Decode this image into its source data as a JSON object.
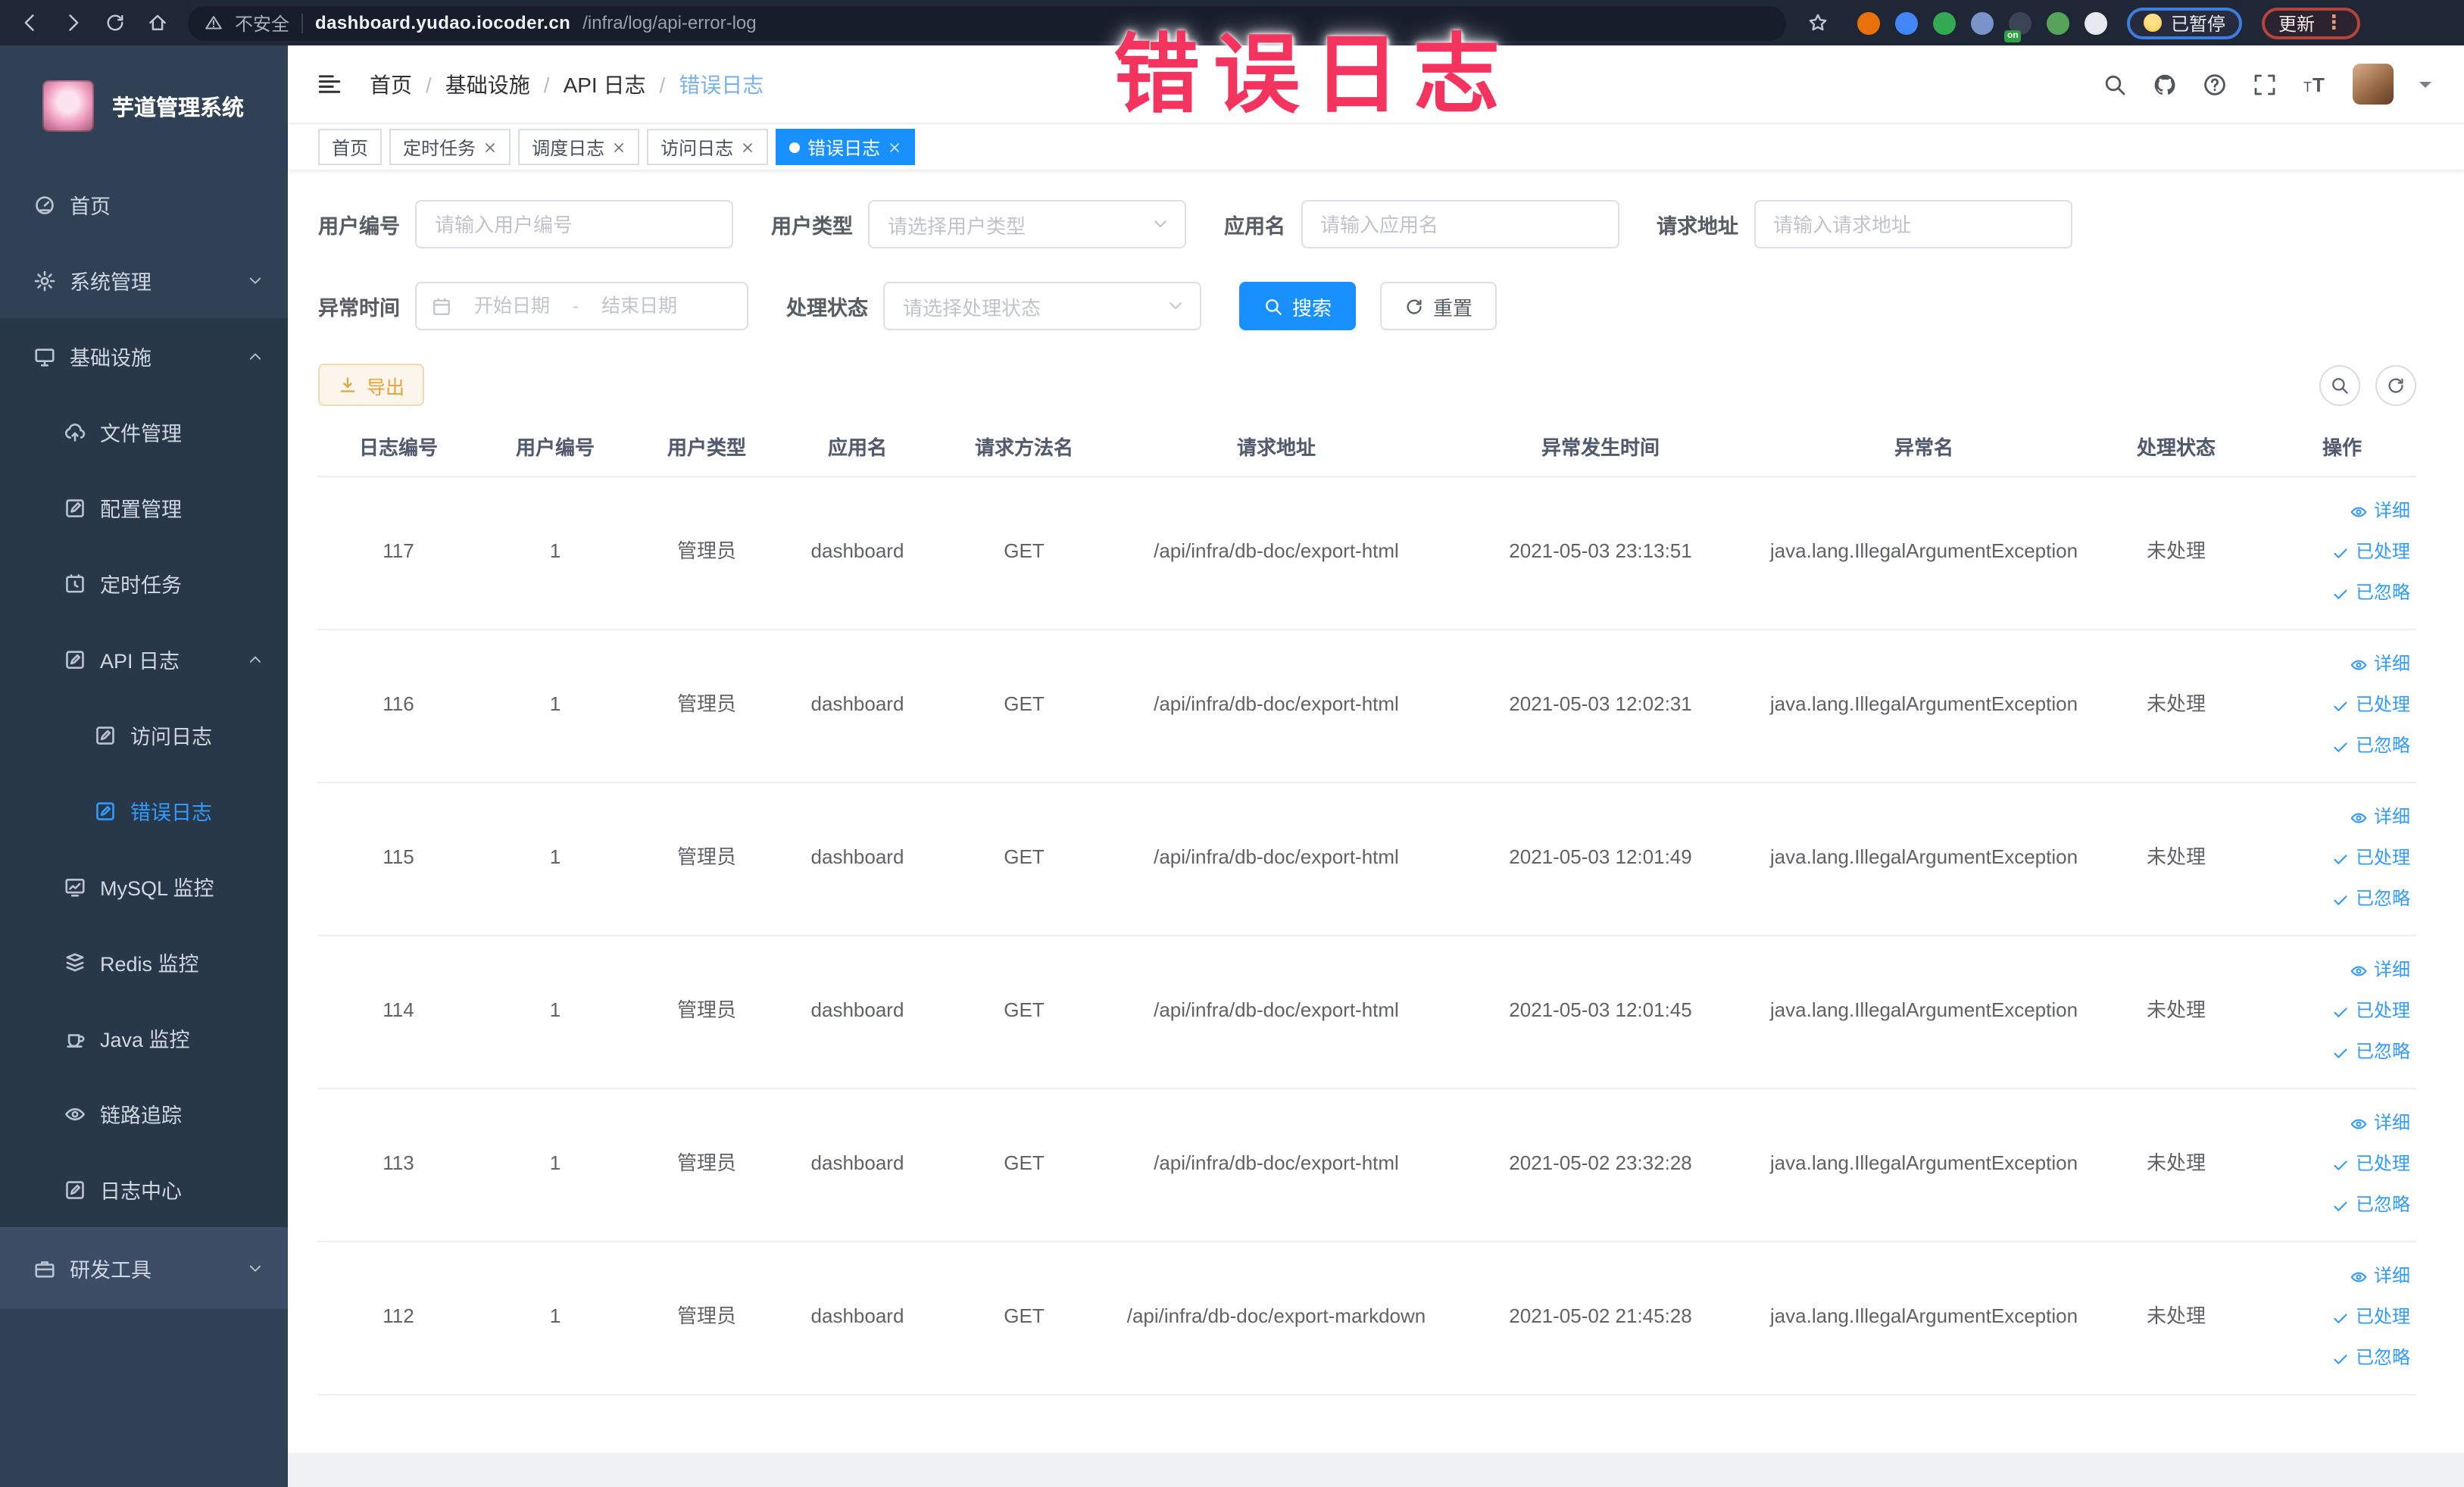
{
  "overlay": {
    "text": "错误日志",
    "color": "#f5335f"
  },
  "browser": {
    "security_label": "不安全",
    "url_domain": "dashboard.yudao.iocoder.cn",
    "url_path": "/infra/log/api-error-log",
    "on_badge": "on",
    "paused_label": "已暂停",
    "update_label": "更新",
    "extensions": [
      {
        "name": "orange-target-extension",
        "color": "#e8710a"
      },
      {
        "name": "blue-shield-extension",
        "color": "#4285f4"
      },
      {
        "name": "green-check-extension",
        "color": "#34a853"
      },
      {
        "name": "blue-grid-extension",
        "color": "#7a93c9"
      },
      {
        "name": "onoff-extension",
        "color": "#3a4454",
        "badge": "on"
      },
      {
        "name": "green-leaf-extension",
        "color": "#56a45c"
      },
      {
        "name": "white-puzzle-extension",
        "color": "#e6e9ef"
      }
    ]
  },
  "sidebar": {
    "logo_title": "芋道管理系统",
    "items": [
      {
        "label": "首页",
        "icon": "gauge",
        "level": 1
      },
      {
        "label": "系统管理",
        "icon": "gear",
        "level": 1,
        "chevron": "down"
      },
      {
        "label": "基础设施",
        "icon": "monitor",
        "level": 1,
        "chevron": "up",
        "section": true
      },
      {
        "label": "文件管理",
        "icon": "cloud-upload",
        "level": 2,
        "section": true
      },
      {
        "label": "配置管理",
        "icon": "edit",
        "level": 2,
        "section": true
      },
      {
        "label": "定时任务",
        "icon": "schedule",
        "level": 2,
        "section": true
      },
      {
        "label": "API 日志",
        "icon": "log",
        "level": 2,
        "chevron": "up",
        "section": true
      },
      {
        "label": "访问日志",
        "icon": "log",
        "level": 3,
        "section": true
      },
      {
        "label": "错误日志",
        "icon": "log",
        "level": 3,
        "section": true,
        "active": true
      },
      {
        "label": "MySQL 监控",
        "icon": "chart",
        "level": 2,
        "section": true
      },
      {
        "label": "Redis 监控",
        "icon": "layers",
        "level": 2,
        "section": true
      },
      {
        "label": "Java 监控",
        "icon": "coffee",
        "level": 2,
        "section": true
      },
      {
        "label": "链路追踪",
        "icon": "eye",
        "level": 2,
        "section": true
      },
      {
        "label": "日志中心",
        "icon": "log",
        "level": 2,
        "section": true
      },
      {
        "label": "研发工具",
        "icon": "briefcase",
        "level": 1,
        "chevron": "down",
        "highlight": true
      }
    ]
  },
  "header": {
    "breadcrumb": [
      "首页",
      "基础设施",
      "API 日志",
      "错误日志"
    ],
    "breadcrumb_separator": "/"
  },
  "tabs": [
    {
      "label": "首页",
      "closable": false,
      "active": false
    },
    {
      "label": "定时任务",
      "closable": true,
      "active": false
    },
    {
      "label": "调度日志",
      "closable": true,
      "active": false
    },
    {
      "label": "访问日志",
      "closable": true,
      "active": false
    },
    {
      "label": "错误日志",
      "closable": true,
      "active": true
    }
  ],
  "filters": {
    "user_id": {
      "label": "用户编号",
      "placeholder": "请输入用户编号"
    },
    "user_type": {
      "label": "用户类型",
      "placeholder": "请选择用户类型"
    },
    "app_name": {
      "label": "应用名",
      "placeholder": "请输入应用名"
    },
    "request_url": {
      "label": "请求地址",
      "placeholder": "请输入请求地址"
    },
    "exception_time": {
      "label": "异常时间",
      "start_placeholder": "开始日期",
      "separator": "-",
      "end_placeholder": "结束日期"
    },
    "process_status": {
      "label": "处理状态",
      "placeholder": "请选择处理状态"
    },
    "search_label": "搜索",
    "reset_label": "重置"
  },
  "toolbar": {
    "export_label": "导出"
  },
  "table": {
    "columns": [
      "日志编号",
      "用户编号",
      "用户类型",
      "应用名",
      "请求方法名",
      "请求地址",
      "异常发生时间",
      "异常名",
      "处理状态",
      "操作"
    ],
    "row_actions": [
      {
        "label": "详细",
        "icon": "eye"
      },
      {
        "label": "已处理",
        "icon": "check"
      },
      {
        "label": "已忽略",
        "icon": "check"
      }
    ],
    "rows": [
      {
        "id": "117",
        "user_id": "1",
        "user_type": "管理员",
        "app_name": "dashboard",
        "method": "GET",
        "url": "/api/infra/db-doc/export-html",
        "time": "2021-05-03 23:13:51",
        "exception": "java.lang.IllegalArgumentException",
        "status": "未处理"
      },
      {
        "id": "116",
        "user_id": "1",
        "user_type": "管理员",
        "app_name": "dashboard",
        "method": "GET",
        "url": "/api/infra/db-doc/export-html",
        "time": "2021-05-03 12:02:31",
        "exception": "java.lang.IllegalArgumentException",
        "status": "未处理"
      },
      {
        "id": "115",
        "user_id": "1",
        "user_type": "管理员",
        "app_name": "dashboard",
        "method": "GET",
        "url": "/api/infra/db-doc/export-html",
        "time": "2021-05-03 12:01:49",
        "exception": "java.lang.IllegalArgumentException",
        "status": "未处理"
      },
      {
        "id": "114",
        "user_id": "1",
        "user_type": "管理员",
        "app_name": "dashboard",
        "method": "GET",
        "url": "/api/infra/db-doc/export-html",
        "time": "2021-05-03 12:01:45",
        "exception": "java.lang.IllegalArgumentException",
        "status": "未处理"
      },
      {
        "id": "113",
        "user_id": "1",
        "user_type": "管理员",
        "app_name": "dashboard",
        "method": "GET",
        "url": "/api/infra/db-doc/export-html",
        "time": "2021-05-02 23:32:28",
        "exception": "java.lang.IllegalArgumentException",
        "status": "未处理"
      },
      {
        "id": "112",
        "user_id": "1",
        "user_type": "管理员",
        "app_name": "dashboard",
        "method": "GET",
        "url": "/api/infra/db-doc/export-markdown",
        "time": "2021-05-02 21:45:28",
        "exception": "java.lang.IllegalArgumentException",
        "status": "未处理"
      }
    ]
  },
  "colors": {
    "primary": "#1890ff",
    "warning": "#e6a23c",
    "sidebar": "#304156",
    "annotation": "#f5335f"
  }
}
